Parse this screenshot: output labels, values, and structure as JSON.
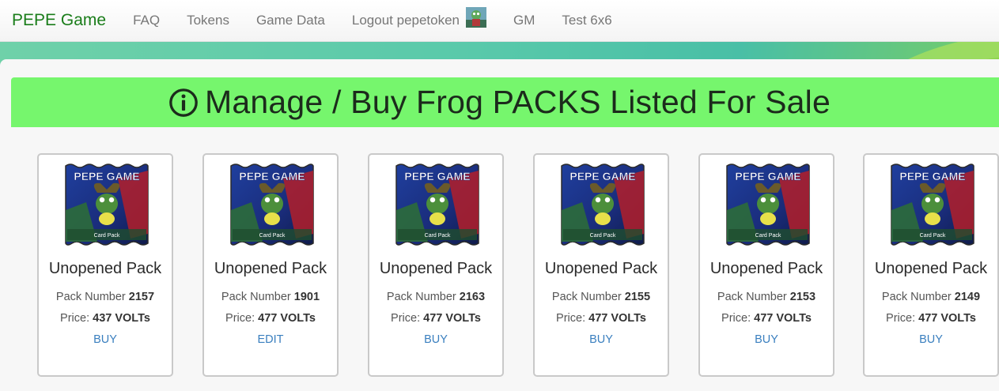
{
  "nav": {
    "brand": "PEPE Game",
    "items": [
      "FAQ",
      "Tokens",
      "Game Data",
      "Logout pepetoken",
      "GM",
      "Test 6x6"
    ]
  },
  "header": {
    "title": "Manage / Buy Frog PACKS Listed For Sale",
    "icon": "info-circle-icon"
  },
  "labels": {
    "pack_number": "Pack Number",
    "price": "Price:"
  },
  "pack_art_text": {
    "top": "PEPE GAME",
    "bottom": "Card Pack"
  },
  "packs": [
    {
      "title": "Unopened Pack",
      "number": "2157",
      "price": "437 VOLTs",
      "action": "BUY"
    },
    {
      "title": "Unopened Pack",
      "number": "1901",
      "price": "477 VOLTs",
      "action": "EDIT"
    },
    {
      "title": "Unopened Pack",
      "number": "2163",
      "price": "477 VOLTs",
      "action": "BUY"
    },
    {
      "title": "Unopened Pack",
      "number": "2155",
      "price": "477 VOLTs",
      "action": "BUY"
    },
    {
      "title": "Unopened Pack",
      "number": "2153",
      "price": "477 VOLTs",
      "action": "BUY"
    },
    {
      "title": "Unopened Pack",
      "number": "2149",
      "price": "477 VOLTs",
      "action": "BUY"
    }
  ],
  "colors": {
    "brand": "#1a7d1a",
    "header_bar": "#76f66d",
    "link": "#3a7fbf"
  }
}
